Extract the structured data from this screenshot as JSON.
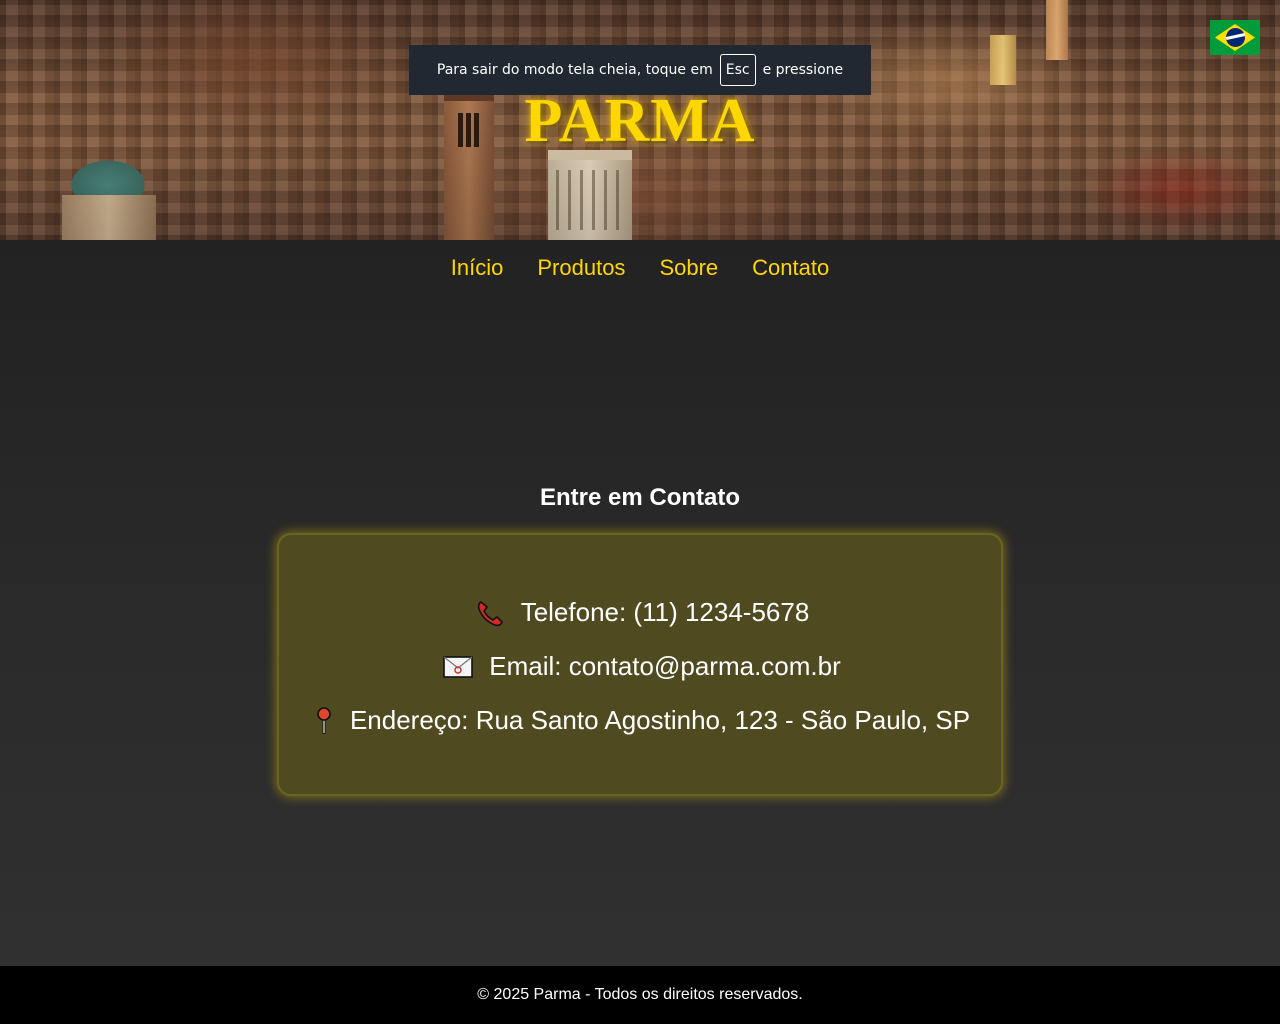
{
  "brand": {
    "logo_text": "PARMA"
  },
  "language": {
    "flag_icon": "brazil-flag-icon"
  },
  "fullscreen_notice": {
    "text_before": "Para sair do modo tela cheia, toque em",
    "key": "Esc",
    "text_after": "e pressione"
  },
  "nav": {
    "items": [
      {
        "label": "Início"
      },
      {
        "label": "Produtos"
      },
      {
        "label": "Sobre"
      },
      {
        "label": "Contato"
      }
    ]
  },
  "contact": {
    "title": "Entre em Contato",
    "phone": {
      "icon": "phone-icon",
      "text": "Telefone: (11) 1234-5678"
    },
    "email": {
      "icon": "envelope-icon",
      "text": "Email: contato@parma.com.br"
    },
    "address": {
      "icon": "pin-icon",
      "text": "Endereço: Rua Santo Agostinho, 123 - São Paulo, SP"
    }
  },
  "footer": {
    "text": "© 2025 Parma - Todos os direitos reservados."
  },
  "colors": {
    "accent": "#ffd700",
    "card_bg": "#4f4a20",
    "page_bg": "#222222",
    "footer_bg": "#000000"
  }
}
